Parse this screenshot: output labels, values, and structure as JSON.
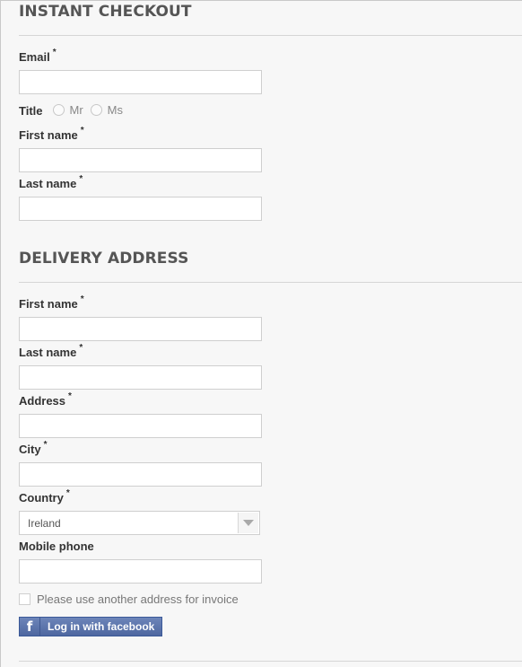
{
  "checkout": {
    "title": "INSTANT CHECKOUT",
    "email_label": "Email",
    "title_label": "Title",
    "title_options": [
      "Mr",
      "Ms"
    ],
    "first_name_label": "First name",
    "last_name_label": "Last name",
    "required_mark": "*"
  },
  "delivery": {
    "title": "DELIVERY ADDRESS",
    "first_name_label": "First name",
    "last_name_label": "Last name",
    "address_label": "Address",
    "city_label": "City",
    "country_label": "Country",
    "country_value": "Ireland",
    "mobile_label": "Mobile phone",
    "invoice_checkbox_label": "Please use another address for invoice",
    "facebook_button_label": "Log in with facebook",
    "facebook_icon_glyph": "f"
  }
}
